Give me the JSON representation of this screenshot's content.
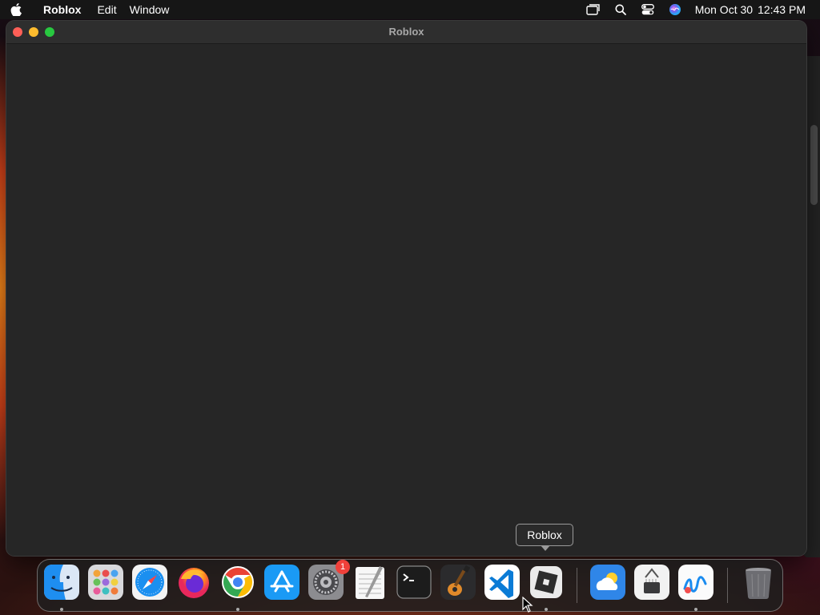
{
  "menubar": {
    "app_name": "Roblox",
    "items": [
      "Edit",
      "Window"
    ],
    "status_icons": [
      "screen-mirroring-icon",
      "spotlight-search-icon",
      "control-center-icon",
      "siri-icon"
    ],
    "clock": {
      "date": "Mon Oct 30",
      "time": "12:43 PM"
    }
  },
  "window": {
    "title": "Roblox"
  },
  "tooltip": {
    "text": "Roblox"
  },
  "dock": {
    "apps": [
      {
        "name": "Finder",
        "icon": "finder-icon",
        "running": true
      },
      {
        "name": "Launchpad",
        "icon": "launchpad-icon",
        "running": false
      },
      {
        "name": "Safari",
        "icon": "safari-icon",
        "running": false
      },
      {
        "name": "Firefox",
        "icon": "firefox-icon",
        "running": false
      },
      {
        "name": "Google Chrome",
        "icon": "chrome-icon",
        "running": true
      },
      {
        "name": "App Store",
        "icon": "app-store-icon",
        "running": false
      },
      {
        "name": "System Settings",
        "icon": "system-settings-icon",
        "running": false,
        "badge": "1"
      },
      {
        "name": "TextEdit",
        "icon": "textedit-icon",
        "running": false
      },
      {
        "name": "Terminal",
        "icon": "terminal-icon",
        "running": false
      },
      {
        "name": "GarageBand",
        "icon": "garageband-icon",
        "running": false
      },
      {
        "name": "Visual Studio Code",
        "icon": "vscode-icon",
        "running": false
      },
      {
        "name": "Roblox",
        "icon": "roblox-icon",
        "running": true
      }
    ],
    "recent": [
      {
        "name": "Weather",
        "icon": "weather-icon",
        "running": false
      },
      {
        "name": "System Information",
        "icon": "system-information-icon",
        "running": false
      },
      {
        "name": "Freeform",
        "icon": "freeform-icon",
        "running": true
      }
    ],
    "trash": {
      "name": "Trash",
      "icon": "trash-icon"
    }
  },
  "colors": {
    "close": "#fe5f57",
    "minimize": "#febc2e",
    "zoom": "#28c840",
    "badge": "#f0403a"
  }
}
